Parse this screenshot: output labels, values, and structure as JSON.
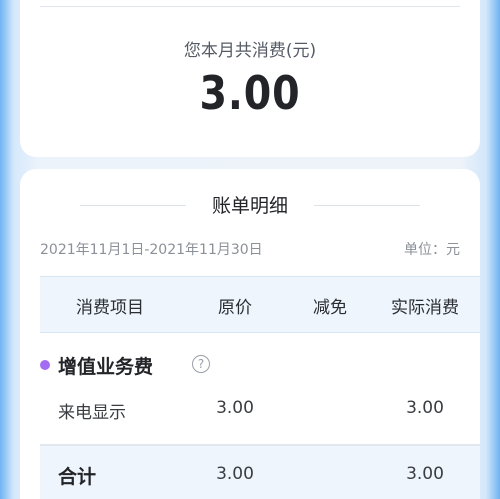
{
  "summary": {
    "label": "您本月共消费(元)",
    "amount": "3.00"
  },
  "detail": {
    "title": "账单明细",
    "period": "2021年11月1日-2021年11月30日",
    "unit": "单位：元",
    "columns": {
      "item": "消费项目",
      "price": "原价",
      "discount": "减免",
      "actual": "实际消费"
    },
    "category": {
      "label": "增值业务费",
      "help_icon": "question-circle-icon",
      "help_glyph": "?"
    },
    "items": [
      {
        "name": "来电显示",
        "price": "3.00",
        "discount": "",
        "actual": "3.00"
      }
    ],
    "total": {
      "label": "合计",
      "price": "3.00",
      "actual": "3.00"
    }
  },
  "colors": {
    "category_dot": "#a46cf0",
    "header_bg": "#eef5fc"
  }
}
